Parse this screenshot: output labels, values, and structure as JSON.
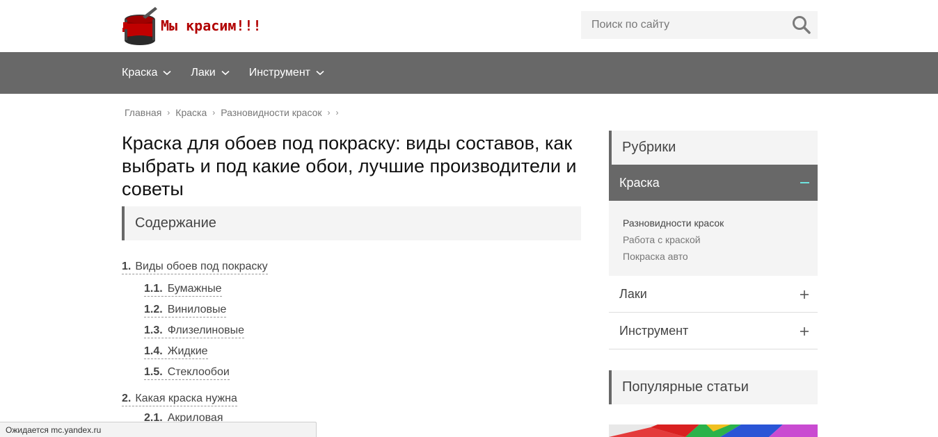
{
  "header": {
    "logo_text": "Мы красим!!!",
    "search": {
      "placeholder": "Поиск по сайту",
      "icon": "search-icon"
    }
  },
  "nav": {
    "items": [
      {
        "label": "Краска"
      },
      {
        "label": "Лаки"
      },
      {
        "label": "Инструмент"
      }
    ]
  },
  "breadcrumb": [
    "Главная",
    "Краска",
    "Разновидности красок"
  ],
  "breadcrumb_separator": "›",
  "article": {
    "title": "Краска для обоев под покраску: виды составов, как выбрать и под какие обои, лучшие производители и советы"
  },
  "toc": {
    "heading": "Содержание",
    "items": [
      {
        "num": "1.",
        "label": "Виды обоев под покраску"
      },
      {
        "num": "1.1.",
        "label": "Бумажные"
      },
      {
        "num": "1.2.",
        "label": "Виниловые"
      },
      {
        "num": "1.3.",
        "label": "Флизелиновые"
      },
      {
        "num": "1.4.",
        "label": "Жидкие"
      },
      {
        "num": "1.5.",
        "label": "Стеклообои"
      },
      {
        "num": "2.",
        "label": "Какая краска нужна"
      },
      {
        "num": "2.1.",
        "label": "Акриловая"
      }
    ]
  },
  "sidebar": {
    "rubrics_heading": "Рубрики",
    "active_category": "Краска",
    "subcategories": [
      "Разновидности красок",
      "Работа с краской",
      "Покраска авто"
    ],
    "categories": [
      "Лаки",
      "Инструмент"
    ],
    "popular_heading": "Популярные статьи"
  },
  "statusbar": {
    "text": "Ожидается mc.yandex.ru"
  },
  "colors": {
    "nav_bg": "#686868",
    "accent_minus": "#6fe3df",
    "logo_red": "#b10000",
    "panel_bg": "#f4f4f4"
  }
}
